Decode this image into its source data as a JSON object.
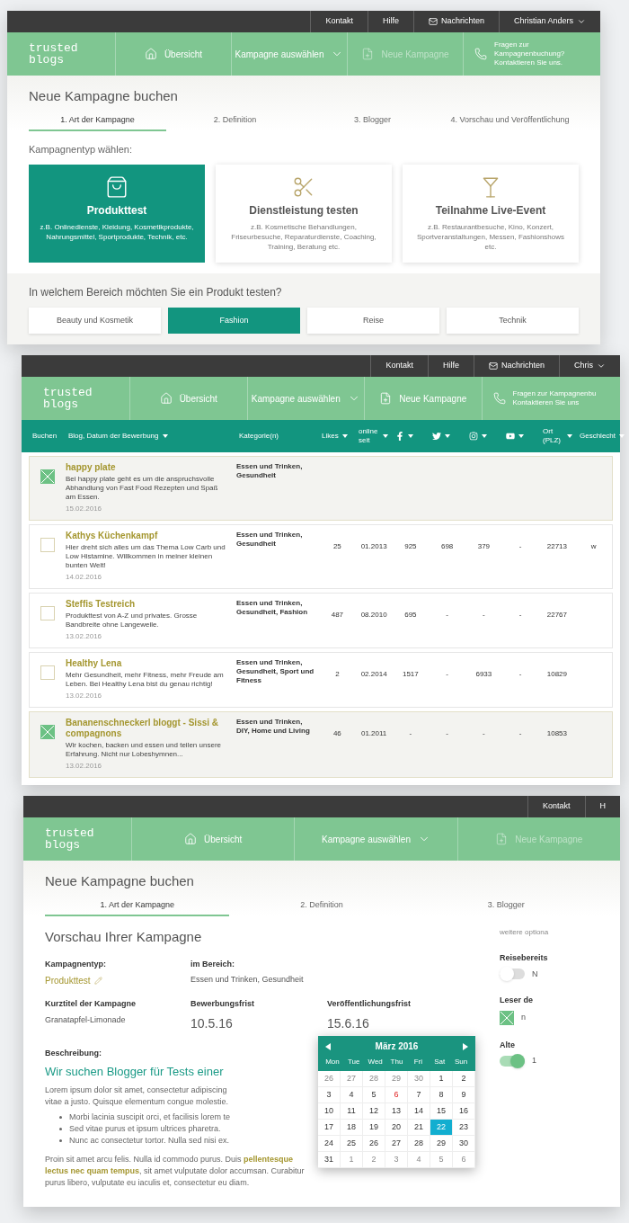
{
  "screen_type_selection": {
    "topbar": [
      {
        "label": "Kontakt",
        "kind": "plain"
      },
      {
        "label": "Hilfe",
        "kind": "plain"
      },
      {
        "label": "Nachrichten",
        "kind": "mail"
      },
      {
        "label": "Christian Anders",
        "kind": "user"
      }
    ],
    "logo": [
      "trusted",
      "blogs"
    ],
    "nav": [
      {
        "label": "Übersicht",
        "kind": "home",
        "disabled": false
      },
      {
        "label": "Kampagne auswählen",
        "kind": "dropdown",
        "disabled": false
      },
      {
        "label": "Neue Kampagne",
        "kind": "new",
        "disabled": true
      }
    ],
    "contact_hint": [
      "Fragen zur Kampagnenbuchung?",
      "Kontaktieren Sie uns."
    ],
    "page_title": "Neue Kampagne buchen",
    "steps": [
      {
        "label": "1. Art der Kampagne",
        "selected": true
      },
      {
        "label": "2. Definition",
        "selected": false
      },
      {
        "label": "3. Blogger",
        "selected": false
      },
      {
        "label": "4. Vorschau und Veröffentlichung",
        "selected": false
      }
    ],
    "section_label": "Kampagnentyp wählen:",
    "type_cards": [
      {
        "title": "Produkttest",
        "description": "z.B. Onlinedienste, Kleidung, Kosmetikprodukte, Nahrungsmittel, Sportprodukte, Technik, etc.",
        "kind": "bag",
        "selected": true
      },
      {
        "title": "Dienstleistung testen",
        "description": "z.B. Kosmetische Behandlungen, Friseurbesuche, Reparaturdienste, Coaching, Training, Beratung etc.",
        "kind": "scissors",
        "selected": false
      },
      {
        "title": "Teilnahme Live-Event",
        "description": "z.B. Restaurantbesuche, Kino, Konzert, Sportveranstaltungen, Messen, Fashionshows etc.",
        "kind": "cocktail",
        "selected": false
      }
    ],
    "question": "In welchem Bereich möchten Sie ein Produkt testen?",
    "areas": [
      {
        "label": "Beauty und Kosmetik",
        "selected": false
      },
      {
        "label": "Fashion",
        "selected": true
      },
      {
        "label": "Reise",
        "selected": false
      },
      {
        "label": "Technik",
        "selected": false
      }
    ]
  },
  "screen_blogger_list": {
    "topbar": [
      {
        "label": "Kontakt",
        "kind": "plain"
      },
      {
        "label": "Hilfe",
        "kind": "plain"
      },
      {
        "label": "Nachrichten",
        "kind": "mail"
      },
      {
        "label": "Chris",
        "kind": "user"
      }
    ],
    "logo": [
      "trusted",
      "blogs"
    ],
    "nav": [
      {
        "label": "Übersicht",
        "kind": "home",
        "disabled": false
      },
      {
        "label": "Kampagne auswählen",
        "kind": "dropdown",
        "disabled": false
      },
      {
        "label": "Neue Kampagne",
        "kind": "new",
        "disabled": false
      }
    ],
    "contact_hint": [
      "Fragen zur Kampagnenbu",
      "Kontaktieren Sie uns"
    ],
    "columns": [
      {
        "label": "Buchen",
        "kind": "text",
        "sortable": false
      },
      {
        "label": "Blog, Datum der Bewerbung",
        "kind": "text",
        "sortable": true
      },
      {
        "label": "Kategorie(n)",
        "kind": "text",
        "sortable": false
      },
      {
        "label": "Likes",
        "kind": "text",
        "sortable": true
      },
      {
        "label": "online seit",
        "kind": "text",
        "sortable": true
      },
      {
        "kind": "facebook",
        "sortable": true
      },
      {
        "kind": "twitter",
        "sortable": true
      },
      {
        "kind": "instagram",
        "sortable": true
      },
      {
        "kind": "youtube",
        "sortable": true
      },
      {
        "label": "Ort (PLZ)",
        "kind": "text",
        "sortable": true
      },
      {
        "label": "Geschlecht",
        "kind": "text",
        "sortable": true
      }
    ],
    "rows": [
      {
        "blog": "happy plate",
        "description": "Bei happy plate geht es um die anspruchsvolle Abhandlung von Fast Food Rezepten und Spaß am Essen.",
        "date": "15.02.2016",
        "selected": true,
        "categories": "Essen und Trinken, Gesundheit",
        "values": []
      },
      {
        "blog": "Kathys Küchenkampf",
        "description": "Hier dreht sich alles um das Thema Low Carb und Low Histamine. Willkommen in meiner kleinen bunten Welt!",
        "date": "14.02.2016",
        "selected": false,
        "categories": "Essen und Trinken, Gesundheit",
        "values": [
          "25",
          "01.2013",
          "925",
          "698",
          "379",
          "-",
          "22713",
          "w"
        ]
      },
      {
        "blog": "Steffis Testreich",
        "description": "Produkttest von A-Z und privates. Grosse Bandbreite ohne Langeweile.",
        "date": "13.02.2016",
        "selected": false,
        "categories": "Essen und Trinken, Gesundheit, Fashion",
        "values": [
          "487",
          "08.2010",
          "695",
          "-",
          "-",
          "-",
          "22767"
        ]
      },
      {
        "blog": "Healthy Lena",
        "description": "Mehr Gesundheit, mehr Fitness, mehr Freude am Leben. Bei Healthy Lena bist du genau richtig!",
        "date": "13.02.2016",
        "selected": false,
        "categories": "Essen und Trinken, Gesundheit, Sport und Fitness",
        "values": [
          "2",
          "02.2014",
          "1517",
          "-",
          "6933",
          "-",
          "10829"
        ]
      },
      {
        "blog": "Bananenschneckerl bloggt - Sissi & compagnons",
        "description": "Wir kochen, backen und essen und teilen unsere Erfahrung. Nicht nur Lobeshymnen...",
        "date": "13.02.2016",
        "selected": true,
        "categories": "Essen und Trinken, DIY, Home und Living",
        "values": [
          "46",
          "01.2011",
          "-",
          "-",
          "-",
          "-",
          "10853"
        ]
      }
    ]
  },
  "screen_preview": {
    "topbar": [
      {
        "label": "Kontakt",
        "kind": "plain"
      },
      {
        "label": "H",
        "kind": "plain"
      }
    ],
    "logo": [
      "trusted",
      "blogs"
    ],
    "nav": [
      {
        "label": "Übersicht",
        "kind": "home",
        "disabled": false
      },
      {
        "label": "Kampagne auswählen",
        "kind": "dropdown",
        "disabled": false
      },
      {
        "label": "Neue Kampagne",
        "kind": "new",
        "disabled": true
      }
    ],
    "page_title": "Neue Kampagne buchen",
    "steps": [
      {
        "label": "1. Art der Kampagne",
        "selected": true
      },
      {
        "label": "2. Definition",
        "selected": false
      },
      {
        "label": "3. Blogger",
        "selected": false
      }
    ],
    "heading": "Vorschau Ihrer Kampagne",
    "fields": [
      {
        "label": "Kampagnentyp:",
        "value": "Produkttest",
        "kind": "editable"
      },
      {
        "label": "im Bereich:",
        "value": "Essen und Trinken, Gesundheit",
        "kind": "plain"
      },
      {
        "label": "Kurztitel der Kampagne",
        "value": "Granatapfel-Limonade",
        "kind": "plain"
      },
      {
        "label": "Bewerbungsfrist",
        "value": "10.5.16",
        "kind": "date"
      },
      {
        "label": "Veröffentlichungsfrist",
        "value": "15.6.16",
        "kind": "date"
      }
    ],
    "description": {
      "label": "Beschreibung:",
      "heading": "Wir suchen Blogger für Tests einer",
      "intro": [
        "Lorem ipsum dolor sit amet, consectetur adipiscing",
        "vitae a justo. Quisque elementum congue molestie."
      ],
      "bullets": [
        "Morbi lacinia suscipit orci, et facilisis lorem te",
        "Sed vitae purus et ipsum ultrices pharetra.",
        "Nunc ac consectetur tortor. Nulla sed nisi ex."
      ],
      "outro": "Proin sit amet arcu felis. Nulla id commodo purus. Duis **pellentesque lectus nec quam tempus**, sit amet vulputate dolor accumsan. Curabitur purus libero, vulputate eu iaculis et, consectetur eu diam."
    },
    "calendar": {
      "month": "März 2016",
      "weekdays": [
        "Mon",
        "Tue",
        "Wed",
        "Thu",
        "Fri",
        "Sat",
        "Sun"
      ],
      "days": [
        {
          "label": "26",
          "kind": "outside",
          "selected": false
        },
        {
          "label": "27",
          "kind": "outside",
          "selected": false
        },
        {
          "label": "28",
          "kind": "outside",
          "selected": false
        },
        {
          "label": "29",
          "kind": "outside",
          "selected": false
        },
        {
          "label": "30",
          "kind": "outside",
          "selected": false
        },
        {
          "label": "1",
          "kind": "day",
          "selected": false
        },
        {
          "label": "2",
          "kind": "day",
          "selected": false
        },
        {
          "label": "3",
          "kind": "day",
          "selected": false
        },
        {
          "label": "4",
          "kind": "day",
          "selected": false
        },
        {
          "label": "5",
          "kind": "day",
          "selected": false
        },
        {
          "label": "6",
          "kind": "holiday",
          "selected": false
        },
        {
          "label": "7",
          "kind": "day",
          "selected": false
        },
        {
          "label": "8",
          "kind": "day",
          "selected": false
        },
        {
          "label": "9",
          "kind": "day",
          "selected": false
        },
        {
          "label": "10",
          "kind": "day",
          "selected": false
        },
        {
          "label": "11",
          "kind": "day",
          "selected": false
        },
        {
          "label": "12",
          "kind": "day",
          "selected": false
        },
        {
          "label": "13",
          "kind": "day",
          "selected": false
        },
        {
          "label": "14",
          "kind": "day",
          "selected": false
        },
        {
          "label": "15",
          "kind": "day",
          "selected": false
        },
        {
          "label": "16",
          "kind": "day",
          "selected": false
        },
        {
          "label": "17",
          "kind": "day",
          "selected": false
        },
        {
          "label": "18",
          "kind": "day",
          "selected": false
        },
        {
          "label": "19",
          "kind": "day",
          "selected": false
        },
        {
          "label": "20",
          "kind": "day",
          "selected": false
        },
        {
          "label": "21",
          "kind": "day",
          "selected": false
        },
        {
          "label": "22",
          "kind": "day",
          "selected": true
        },
        {
          "label": "23",
          "kind": "day",
          "selected": false
        },
        {
          "label": "24",
          "kind": "day",
          "selected": false
        },
        {
          "label": "25",
          "kind": "day",
          "selected": false
        },
        {
          "label": "26",
          "kind": "day",
          "selected": false
        },
        {
          "label": "27",
          "kind": "day",
          "selected": false
        },
        {
          "label": "28",
          "kind": "day",
          "selected": false
        },
        {
          "label": "29",
          "kind": "day",
          "selected": false
        },
        {
          "label": "30",
          "kind": "day",
          "selected": false
        },
        {
          "label": "31",
          "kind": "day",
          "selected": false
        },
        {
          "label": "1",
          "kind": "outside",
          "selected": false
        },
        {
          "label": "2",
          "kind": "outside",
          "selected": false
        },
        {
          "label": "3",
          "kind": "outside",
          "selected": false
        },
        {
          "label": "4",
          "kind": "outside",
          "selected": false
        },
        {
          "label": "5",
          "kind": "outside",
          "selected": false
        },
        {
          "label": "6",
          "kind": "outside",
          "selected": false
        }
      ]
    },
    "side_options": {
      "heading": "weitere optiona",
      "items": [
        {
          "label": "Reisebereits",
          "kind": "toggle",
          "on": false,
          "value": "N"
        },
        {
          "label": "Leser de",
          "kind": "checkbox",
          "checked": true,
          "value": "n"
        },
        {
          "label": "Alte",
          "kind": "toggle",
          "on": true,
          "value": "1"
        }
      ]
    }
  }
}
